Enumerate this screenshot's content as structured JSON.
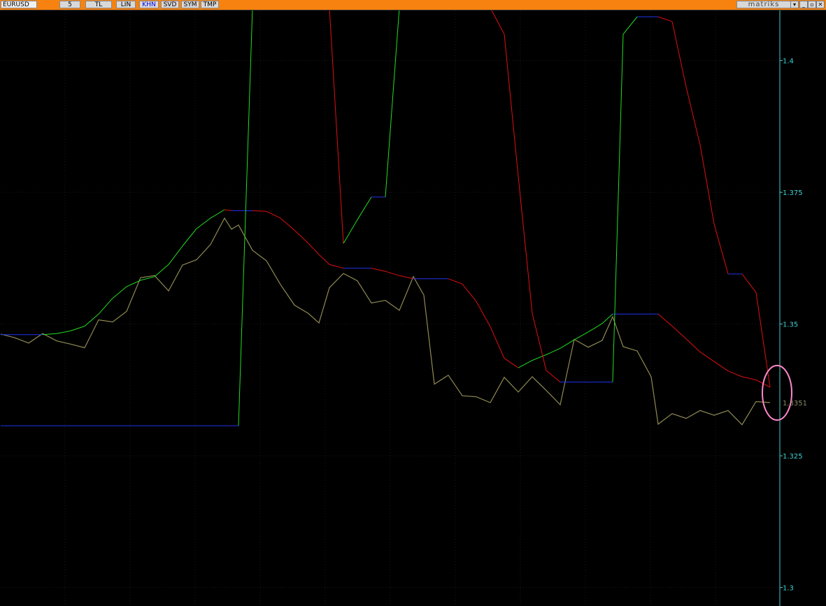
{
  "toolbar": {
    "symbol": "EURUSD",
    "period": "5",
    "buttons": [
      "TL",
      "LIN",
      "KHN",
      "SVD",
      "SYM",
      "TMP"
    ],
    "active_button": "KHN",
    "brand": "matriks",
    "window_controls": [
      "▾",
      "_",
      "▫",
      "✕"
    ]
  },
  "colors": {
    "toolbar": "#f7820f",
    "background": "#000000",
    "price": "#8f8a52",
    "trail_up": "#22dd22",
    "trail_down": "#e01010",
    "flat": "#2233ee",
    "axis": "#3fd0d0",
    "highlight": "#ff88cc"
  },
  "chart_data": {
    "type": "line",
    "symbol": "EURUSD",
    "ylim": [
      1.2965,
      1.4095
    ],
    "yticks": [
      1.3,
      1.325,
      1.35,
      1.375,
      1.4
    ],
    "ytick_labels": [
      "1.3",
      "1.325",
      "1.35",
      "1.375",
      "1.4"
    ],
    "last_value_label": "1.3351",
    "grid": true,
    "x": [
      0,
      20,
      40,
      60,
      80,
      100,
      120,
      140,
      160,
      180,
      200,
      220,
      240,
      260,
      280,
      300,
      320,
      330,
      340,
      360,
      380,
      400,
      420,
      440,
      455,
      470,
      490,
      510,
      530,
      550,
      570,
      590,
      605,
      620,
      640,
      660,
      680,
      700,
      720,
      740,
      760,
      780,
      800,
      820,
      840,
      860,
      875,
      890,
      910,
      930,
      940,
      960,
      980,
      1000,
      1020,
      1040,
      1060,
      1080,
      1100
    ],
    "series": [
      {
        "values": [
          1.3481,
          1.3474,
          1.3464,
          1.3482,
          1.3468,
          1.3462,
          1.3455,
          1.3508,
          1.3504,
          1.3524,
          1.3588,
          1.3592,
          1.3563,
          1.3612,
          1.3622,
          1.3651,
          1.3701,
          1.368,
          1.3688,
          1.364,
          1.362,
          1.3575,
          1.3536,
          1.352,
          1.3502,
          1.3569,
          1.3596,
          1.3582,
          1.354,
          1.3545,
          1.3526,
          1.359,
          1.3555,
          1.3386,
          1.3403,
          1.3364,
          1.3362,
          1.3351,
          1.3399,
          1.3371,
          1.34,
          1.3374,
          1.3347,
          1.3471,
          1.3456,
          1.3469,
          1.3514,
          1.3457,
          1.3449,
          1.34,
          1.331,
          1.333,
          1.3321,
          1.3336,
          1.3327,
          1.3336,
          1.3309,
          1.3353,
          1.3351
        ]
      },
      {
        "values": [
          1.348,
          1.348,
          1.348,
          1.348,
          1.3482,
          1.3487,
          1.3496,
          1.3519,
          1.3549,
          1.3571,
          1.3583,
          1.359,
          1.3613,
          1.3648,
          1.3681,
          1.3701,
          1.3717,
          1.3715,
          1.3715,
          1.3715,
          1.3714,
          1.3701,
          1.3678,
          1.3653,
          1.3632,
          1.3613,
          1.3606,
          1.3606,
          1.3606,
          1.36,
          1.3592,
          1.3586,
          1.3586,
          1.3586,
          1.3586,
          1.3576,
          1.3543,
          1.3495,
          1.3435,
          1.3417,
          1.3431,
          1.3442,
          1.3454,
          1.347,
          1.3485,
          1.3501,
          1.3519,
          1.3519,
          1.3519,
          1.3519,
          1.3519,
          1.3496,
          1.3472,
          1.3447,
          1.3429,
          1.3411,
          1.34,
          1.3394,
          1.338
        ]
      },
      {
        "values": [
          1.3307,
          1.3307,
          1.3307,
          1.3307,
          1.3307,
          1.3307,
          1.3307,
          1.3307,
          1.3307,
          1.3307,
          1.3307,
          1.3307,
          1.3307,
          1.3307,
          1.3307,
          1.3307,
          1.3307,
          1.3307,
          1.3307,
          1.41,
          1.41,
          1.41,
          1.41,
          1.41,
          1.41,
          1.41,
          1.3653,
          1.3698,
          1.3741,
          1.3741,
          1.41,
          1.41,
          1.41,
          1.41,
          1.41,
          1.41,
          1.41,
          1.41,
          1.405,
          1.378,
          1.352,
          1.3412,
          1.339,
          1.339,
          1.339,
          1.339,
          1.339,
          1.405,
          1.4083,
          1.4083,
          1.4083,
          1.4074,
          1.395,
          1.384,
          1.369,
          1.3595,
          1.3595,
          1.356,
          1.338
        ]
      }
    ]
  }
}
